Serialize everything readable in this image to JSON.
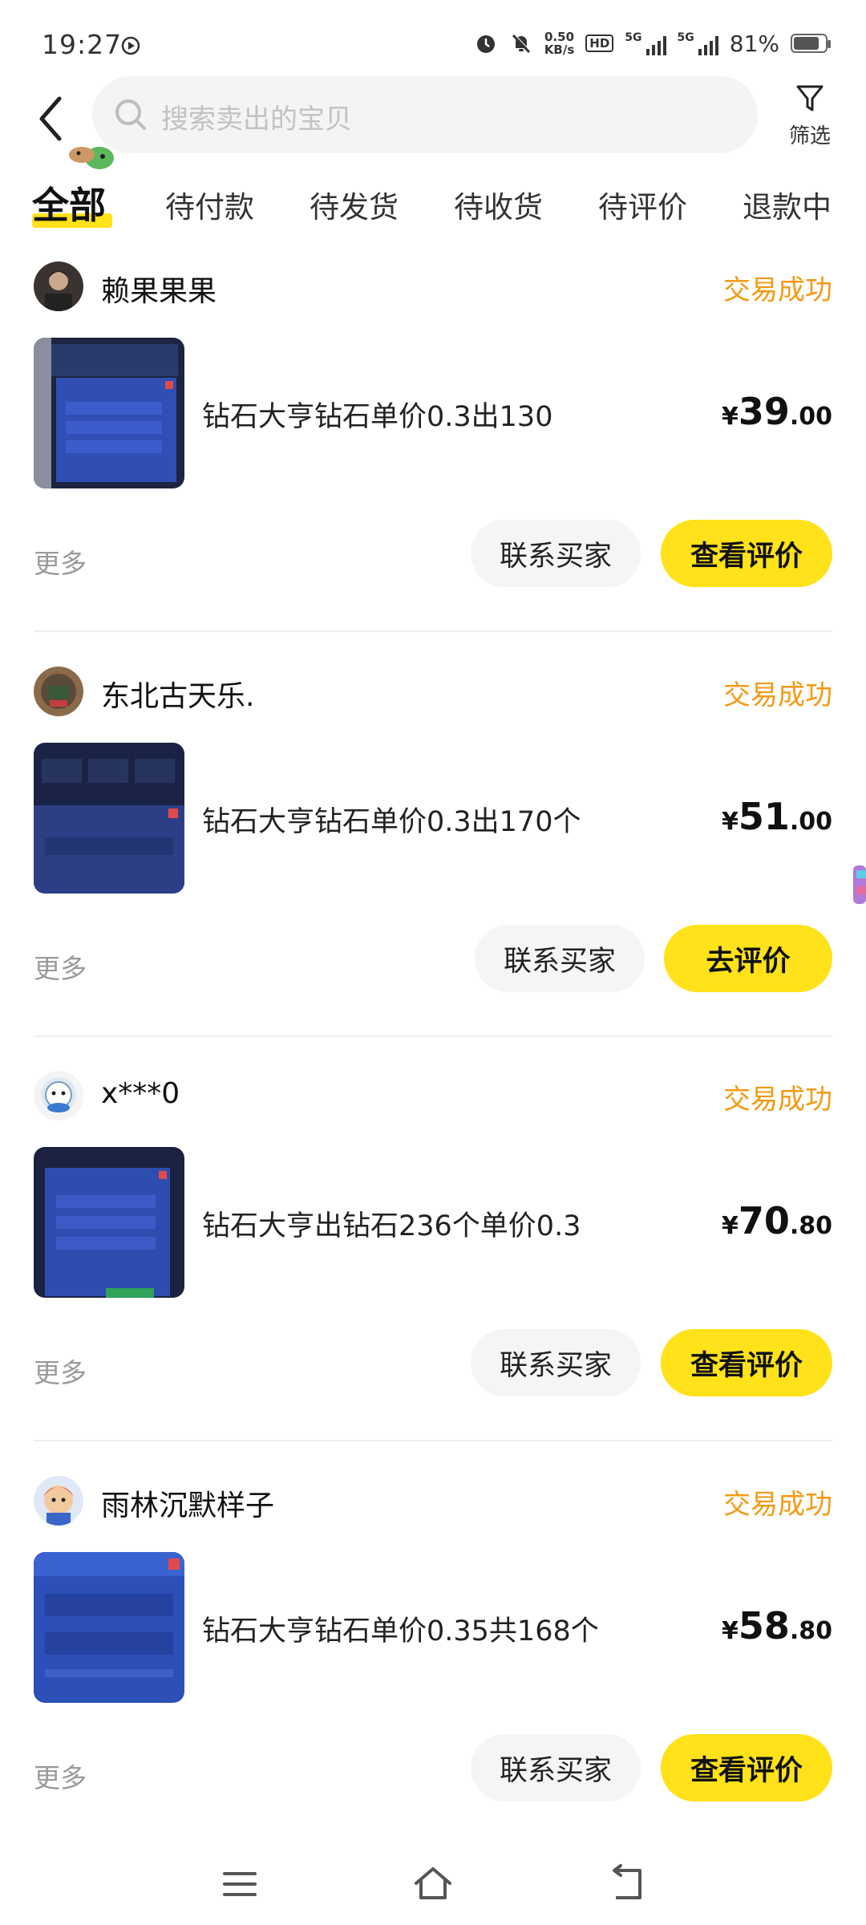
{
  "status_bar": {
    "time": "19:27",
    "net_speed_value": "0.50",
    "net_speed_unit": "KB/s",
    "hd": "HD",
    "network_1": "5G",
    "network_2": "5G",
    "battery": "81%",
    "battery_level": 0.81
  },
  "header": {
    "search_placeholder": "搜索卖出的宝贝",
    "filter_label": "筛选"
  },
  "tabs": [
    {
      "label": "全部",
      "active": true
    },
    {
      "label": "待付款"
    },
    {
      "label": "待发货"
    },
    {
      "label": "待收货"
    },
    {
      "label": "待评价"
    },
    {
      "label": "退款中"
    }
  ],
  "orders": [
    {
      "buyer": "赖果果果",
      "status": "交易成功",
      "title": "钻石大亨钻石单价0.3出130",
      "price_symbol": "¥",
      "price_int": "39",
      "price_dec": ".00",
      "more": "更多",
      "contact_label": "联系买家",
      "action_label": "查看评价"
    },
    {
      "buyer": "东北古天乐.",
      "status": "交易成功",
      "title": "钻石大亨钻石单价0.3出170个",
      "price_symbol": "¥",
      "price_int": "51",
      "price_dec": ".00",
      "more": "更多",
      "contact_label": "联系买家",
      "action_label": "去评价"
    },
    {
      "buyer": "x***0",
      "status": "交易成功",
      "title": "钻石大亨出钻石236个单价0.3",
      "price_symbol": "¥",
      "price_int": "70",
      "price_dec": ".80",
      "more": "更多",
      "contact_label": "联系买家",
      "action_label": "查看评价"
    },
    {
      "buyer": "雨林沉默样子",
      "status": "交易成功",
      "title": "钻石大亨钻石单价0.35共168个",
      "price_symbol": "¥",
      "price_int": "58",
      "price_dec": ".80",
      "more": "更多",
      "contact_label": "联系买家",
      "action_label": "查看评价"
    }
  ],
  "colors": {
    "accent_yellow": "#ffe21a",
    "status_orange": "#f39a14",
    "muted_text": "#9a9a9a"
  },
  "icons": {
    "back": "chevron-left-icon",
    "search": "search-icon",
    "filter": "funnel-icon",
    "nav_menu": "menu-icon",
    "nav_home": "home-icon",
    "nav_back": "return-icon"
  }
}
